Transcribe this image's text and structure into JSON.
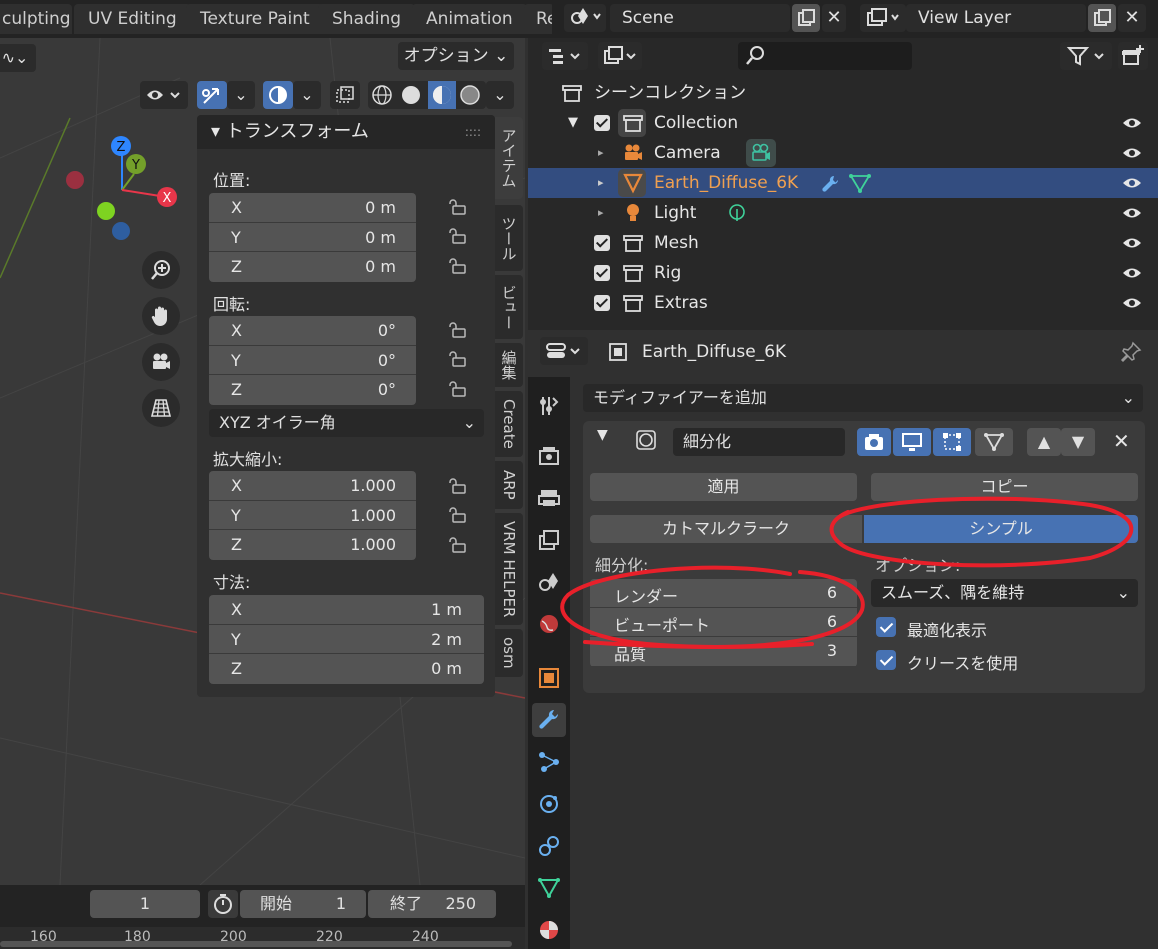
{
  "workspace_tabs": [
    "culpting",
    "UV Editing",
    "Texture Paint",
    "Shading",
    "Animation",
    "Re"
  ],
  "scene": {
    "name": "Scene",
    "view_layer": "View Layer"
  },
  "viewport": {
    "options_label": "オプション",
    "gizmo_axes": [
      "Z",
      "Y",
      "X"
    ]
  },
  "npanel": {
    "title": "トランスフォーム",
    "location_label": "位置:",
    "location": [
      {
        "axis": "X",
        "value": "0 m"
      },
      {
        "axis": "Y",
        "value": "0 m"
      },
      {
        "axis": "Z",
        "value": "0 m"
      }
    ],
    "rotation_label": "回転:",
    "rotation": [
      {
        "axis": "X",
        "value": "0°"
      },
      {
        "axis": "Y",
        "value": "0°"
      },
      {
        "axis": "Z",
        "value": "0°"
      }
    ],
    "rotation_mode": "XYZ オイラー角",
    "scale_label": "拡大縮小:",
    "scale": [
      {
        "axis": "X",
        "value": "1.000"
      },
      {
        "axis": "Y",
        "value": "1.000"
      },
      {
        "axis": "Z",
        "value": "1.000"
      }
    ],
    "dimensions_label": "寸法:",
    "dimensions": [
      {
        "axis": "X",
        "value": "1 m"
      },
      {
        "axis": "Y",
        "value": "2 m"
      },
      {
        "axis": "Z",
        "value": "0 m"
      }
    ]
  },
  "sidebar_tabs": [
    "アイテム",
    "ツール",
    "ビュー",
    "編集",
    "Create",
    "ARP",
    "VRM HELPER",
    "osm"
  ],
  "timeline": {
    "current_frame": "1",
    "start_label": "開始",
    "start": "1",
    "end_label": "終了",
    "end": "250",
    "ruler": [
      "160",
      "180",
      "200",
      "220",
      "240"
    ]
  },
  "outliner": {
    "root": "シーンコレクション",
    "items": [
      {
        "name": "Collection"
      },
      {
        "name": "Camera"
      },
      {
        "name": "Earth_Diffuse_6K"
      },
      {
        "name": "Light"
      },
      {
        "name": "Mesh"
      },
      {
        "name": "Rig"
      },
      {
        "name": "Extras"
      }
    ]
  },
  "properties": {
    "object_name": "Earth_Diffuse_6K",
    "add_modifier": "モディファイアーを追加",
    "modifier_name": "細分化",
    "apply": "適用",
    "copy": "コピー",
    "catmull_clark": "カトマルクラーク",
    "simple": "シンプル",
    "subdiv_label": "細分化:",
    "options_label": "オプション:",
    "render_label": "レンダー",
    "render_value": "6",
    "viewport_label": "ビューポート",
    "viewport_value": "6",
    "quality_label": "品質",
    "quality_value": "3",
    "uv_smooth": "スムーズ、隅を維持",
    "optimal_display": "最適化表示",
    "use_crease": "クリースを使用"
  },
  "colors": {
    "accent": "#4772b3",
    "annotation": "#e8202a",
    "selected_row": "#334d80",
    "object_orange": "#e8883a"
  }
}
